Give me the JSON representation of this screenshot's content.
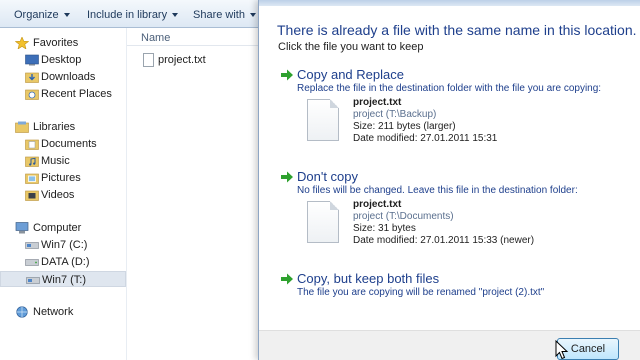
{
  "toolbar": {
    "organize": "Organize",
    "include_in_library": "Include in library",
    "share_with": "Share with"
  },
  "nav": {
    "favorites": "Favorites",
    "desktop": "Desktop",
    "downloads": "Downloads",
    "recent_places": "Recent Places",
    "libraries": "Libraries",
    "documents": "Documents",
    "music": "Music",
    "pictures": "Pictures",
    "videos": "Videos",
    "computer": "Computer",
    "drive_c": "Win7 (C:)",
    "drive_d": "DATA (D:)",
    "drive_t": "Win7 (T:)",
    "network": "Network"
  },
  "file_list": {
    "column_name": "Name",
    "files": [
      {
        "name": "project.txt"
      }
    ]
  },
  "dialog": {
    "heading": "There is already a file with the same name in this location.",
    "subheading": "Click the file you want to keep",
    "copy_replace": {
      "title": "Copy and Replace",
      "description": "Replace the file in the destination folder with the file you are copying:",
      "file_name": "project.txt",
      "location": "project (T:\\Backup)",
      "size": "Size: 211 bytes (larger)",
      "date": "Date modified: 27.01.2011 15:31"
    },
    "dont_copy": {
      "title": "Don't copy",
      "description": "No files will be changed. Leave this file in the destination folder:",
      "file_name": "project.txt",
      "location": "project (T:\\Documents)",
      "size": "Size: 31 bytes",
      "date": "Date modified: 27.01.2011 15:33 (newer)"
    },
    "keep_both": {
      "title": "Copy, but keep both files",
      "description": "The file you are copying will be renamed \"project (2).txt\""
    },
    "cancel": "Cancel"
  },
  "colors": {
    "link_blue": "#1e3f8c",
    "arrow_green": "#2ea12e",
    "toolbar_text": "#1e395b",
    "selection": "#dfe6ef"
  },
  "icons": {
    "option_arrow": "green-arrow-icon",
    "favorites": "star-icon",
    "folder": "folder-icon",
    "library": "library-icon",
    "computer": "computer-icon",
    "drive": "drive-icon",
    "network": "network-icon",
    "document": "document-icon",
    "cursor": "mouse-pointer-icon"
  }
}
